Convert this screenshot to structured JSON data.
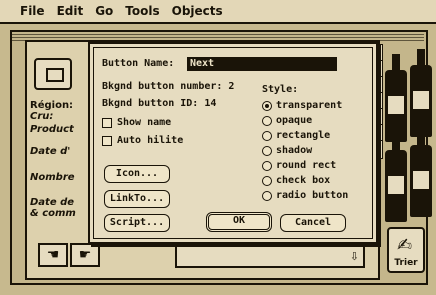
{
  "menubar": {
    "apple": "",
    "items": [
      "File",
      "Edit",
      "Go",
      "Tools",
      "Objects"
    ]
  },
  "card": {
    "labels": [
      "Région:",
      "Cru:",
      "Product",
      "Date d'",
      "Nombre",
      "Date de",
      "& comm"
    ]
  },
  "dialog": {
    "name_label": "Button Name:",
    "name_value": "Next",
    "bkgnd_number": "Bkgnd button number: 2",
    "bkgnd_id": "Bkgnd button ID: 14",
    "show_name": "Show name",
    "auto_hilite": "Auto hilite",
    "style_label": "Style:",
    "styles": [
      "transparent",
      "opaque",
      "rectangle",
      "shadow",
      "round rect",
      "check box",
      "radio button"
    ],
    "icon_button": "Icon...",
    "linkto_button": "LinkTo...",
    "script_button": "Script...",
    "ok_button": "OK",
    "cancel_button": "Cancel"
  },
  "trier": {
    "label": "Trier"
  }
}
